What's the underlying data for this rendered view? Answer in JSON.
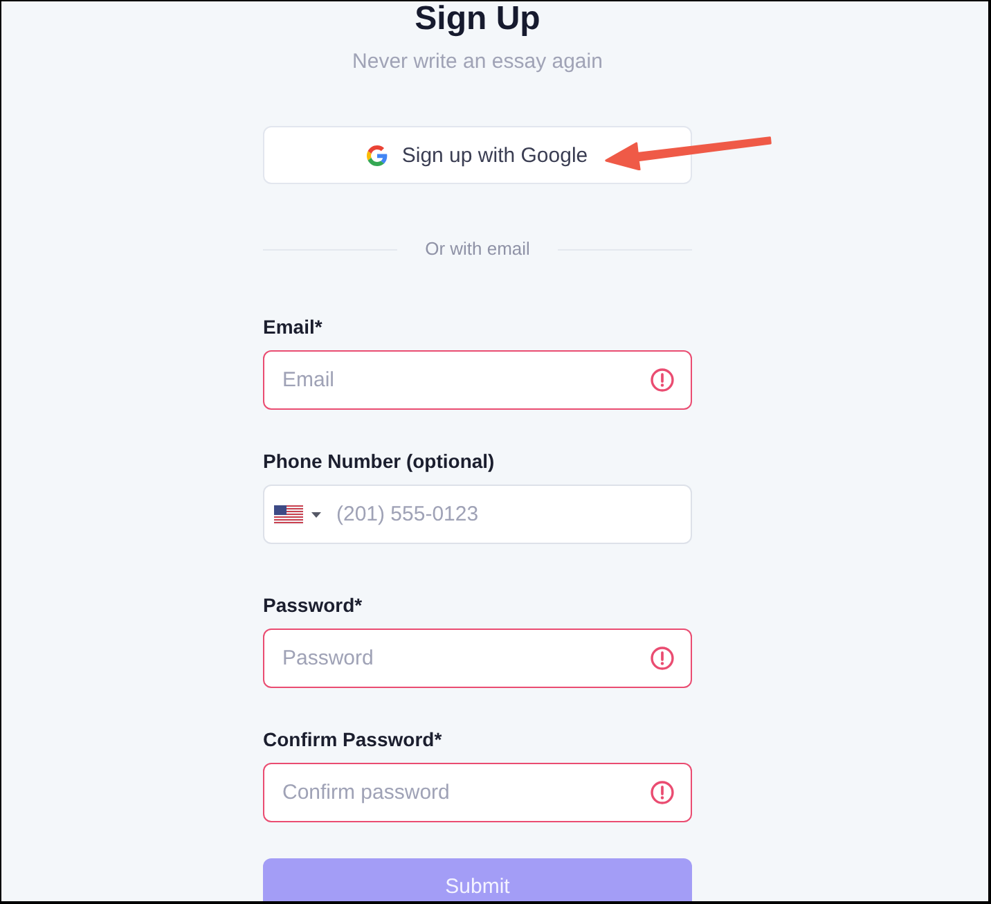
{
  "header": {
    "title": "Sign Up",
    "subtitle": "Never write an essay again"
  },
  "google_button": {
    "label": "Sign up with Google"
  },
  "divider": {
    "label": "Or with email"
  },
  "fields": [
    {
      "kind": "email",
      "label": "Email*",
      "placeholder": "Email",
      "error": true
    },
    {
      "kind": "phone",
      "label": "Phone Number (optional)",
      "placeholder": "(201) 555-0123",
      "error": false
    },
    {
      "kind": "password",
      "label": "Password*",
      "placeholder": "Password",
      "error": true
    },
    {
      "kind": "password",
      "label": "Confirm Password*",
      "placeholder": "Confirm password",
      "error": true
    }
  ],
  "submit_button": {
    "label": "Submit",
    "disabled": true
  },
  "annotation": {
    "kind": "arrow"
  }
}
